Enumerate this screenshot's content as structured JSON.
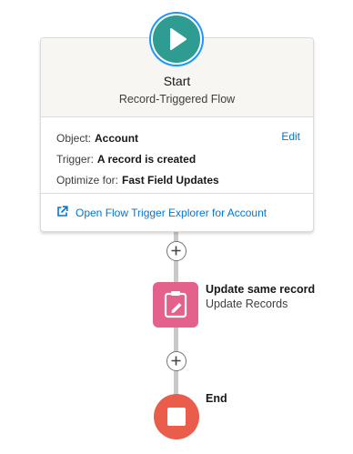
{
  "start": {
    "title": "Start",
    "subtitle": "Record-Triggered Flow",
    "object_label": "Object:",
    "object_value": "Account",
    "edit_label": "Edit",
    "trigger_label": "Trigger:",
    "trigger_value": "A record is created",
    "optimize_label": "Optimize for:",
    "optimize_value": "Fast Field Updates",
    "explorer_link": "Open Flow Trigger Explorer for Account"
  },
  "elements": [
    {
      "label": "Update same record",
      "type": "Update Records",
      "icon": "clipboard-edit-icon",
      "color": "#e3618b"
    }
  ],
  "end": {
    "label": "End",
    "color": "#ea5d4a"
  },
  "colors": {
    "start": "#2e9c91",
    "link": "#0176d3",
    "connector": "#c9c9c9"
  }
}
